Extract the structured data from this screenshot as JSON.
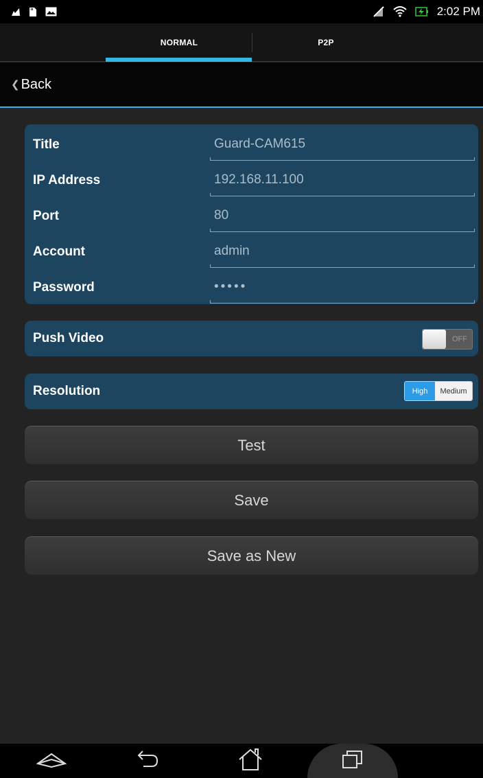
{
  "status_bar": {
    "time": "2:02 PM",
    "left_icons": [
      "notification-icon",
      "sd-card-icon",
      "image-icon"
    ],
    "right_icons": [
      "no-sim-icon",
      "wifi-icon",
      "battery-charging-icon"
    ]
  },
  "tabs": [
    {
      "label": "NORMAL",
      "selected": true
    },
    {
      "label": "P2P",
      "selected": false
    }
  ],
  "action_bar": {
    "back_label": "Back"
  },
  "form": {
    "fields": [
      {
        "label": "Title",
        "value": "Guard-CAM615"
      },
      {
        "label": "IP Address",
        "value": "192.168.11.100"
      },
      {
        "label": "Port",
        "value": "80"
      },
      {
        "label": "Account",
        "value": "admin"
      },
      {
        "label": "Password",
        "value": "•••••"
      }
    ]
  },
  "push_video": {
    "label": "Push Video",
    "toggle_text": "OFF",
    "enabled": false
  },
  "resolution": {
    "label": "Resolution",
    "options": [
      "High",
      "Medium"
    ],
    "selected": "High"
  },
  "buttons": {
    "test": "Test",
    "save": "Save",
    "save_as_new": "Save as New"
  },
  "colors": {
    "accent": "#33b5e5",
    "panel": "#1d4560",
    "background": "#232323"
  }
}
